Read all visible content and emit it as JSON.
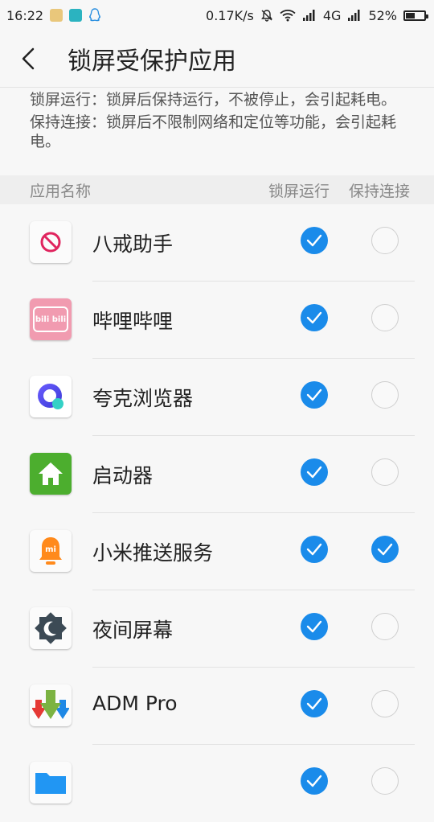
{
  "status": {
    "time": "16:22",
    "net_speed": "0.17K/s",
    "network": "4G",
    "battery": "52%",
    "battery_level": 0.52
  },
  "header": {
    "title": "锁屏受保护应用"
  },
  "desc": {
    "line1": "锁屏运行：锁屏后保持运行，不被停止，会引起耗电。",
    "line2": "保持连接：锁屏后不限制网络和定位等功能，会引起耗电。"
  },
  "columns": {
    "name": "应用名称",
    "run": "锁屏运行",
    "connect": "保持连接"
  },
  "apps": [
    {
      "name": "八戒助手",
      "icon": "ban-icon",
      "run": true,
      "connect": false
    },
    {
      "name": "哔哩哔哩",
      "icon": "bilibili-icon",
      "icon_text": "bili bili",
      "run": true,
      "connect": false
    },
    {
      "name": "夸克浏览器",
      "icon": "quark-icon",
      "run": true,
      "connect": false
    },
    {
      "name": "启动器",
      "icon": "home-icon",
      "run": true,
      "connect": false
    },
    {
      "name": "小米推送服务",
      "icon": "bell-icon",
      "icon_text": "mi",
      "run": true,
      "connect": true
    },
    {
      "name": "夜间屏幕",
      "icon": "moon-gear-icon",
      "run": true,
      "connect": false
    },
    {
      "name": "ADM Pro",
      "icon": "download-arrows-icon",
      "run": true,
      "connect": false
    },
    {
      "name": "",
      "icon": "folder-icon",
      "run": true,
      "connect": false
    }
  ],
  "colors": {
    "accent": "#1a8bea",
    "bg": "#f7f7f7"
  }
}
